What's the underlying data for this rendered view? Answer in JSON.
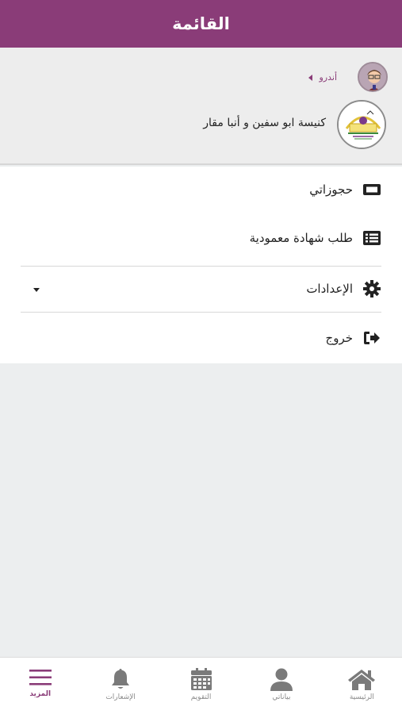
{
  "header": {
    "title": "القائمة"
  },
  "profile": {
    "user_name": "أندرو",
    "church_name": "كنيسة ابو سفين و أنبا مقار"
  },
  "menu": {
    "items": [
      {
        "label": "حجوزاتي",
        "icon": "ticket-icon"
      },
      {
        "label": "طلب شهادة معمودية",
        "icon": "list-icon"
      },
      {
        "label": "الإعدادات",
        "icon": "gear-icon"
      },
      {
        "label": "خروج",
        "icon": "sign-out-icon"
      }
    ]
  },
  "bottom_nav": {
    "items": [
      {
        "label": "المزيد",
        "icon": "hamburger-icon",
        "active": true
      },
      {
        "label": "الإشعارات",
        "icon": "bell-icon",
        "active": false
      },
      {
        "label": "التقويم",
        "icon": "calendar-icon",
        "active": false
      },
      {
        "label": "بياناتي",
        "icon": "user-icon",
        "active": false
      },
      {
        "label": "الرئيسية",
        "icon": "home-icon",
        "active": false
      }
    ]
  },
  "colors": {
    "brand": "#8a3c78",
    "inactive_icon": "#7a7a7a",
    "background": "#eceeef"
  }
}
